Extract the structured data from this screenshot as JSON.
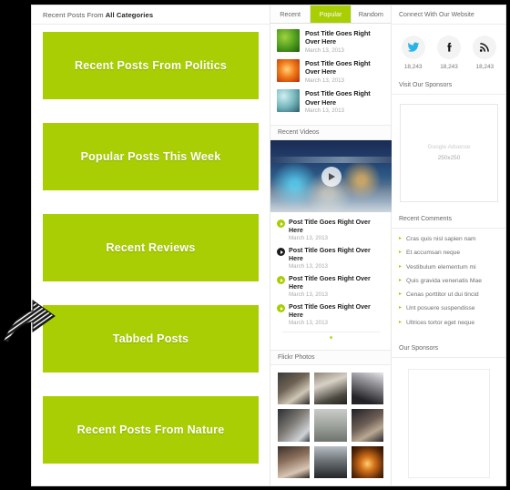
{
  "theme": {
    "accent": "#a9ce04",
    "page_bg": "#000000",
    "canvas_bg": "#ffffff"
  },
  "main": {
    "header_prefix": "Recent Posts From ",
    "header_strong": "All Categories",
    "blocks": [
      {
        "label": "Recent Posts From Politics"
      },
      {
        "label": "Popular Posts This Week"
      },
      {
        "label": "Recent Reviews"
      },
      {
        "label": "Tabbed Posts"
      },
      {
        "label": "Recent Posts From Nature"
      }
    ]
  },
  "middle": {
    "tabs": [
      {
        "label": "Recent",
        "active": false
      },
      {
        "label": "Popular",
        "active": true
      },
      {
        "label": "Random",
        "active": false
      }
    ],
    "posts": [
      {
        "title": "Post Title Goes Right Over Here",
        "date": "March 13, 2013",
        "thumb": "green-leaf-thumb"
      },
      {
        "title": "Post Title Goes Right Over Here",
        "date": "March 13, 2013",
        "thumb": "orange-flower-thumb"
      },
      {
        "title": "Post Title Goes Right Over Here",
        "date": "March 13, 2013",
        "thumb": "teal-water-thumb"
      }
    ],
    "videos_heading": "Recent Videos",
    "video_player": {
      "image": "city-night-street-photo",
      "play_icon": "play-icon"
    },
    "video_list": [
      {
        "title": "Post Title Goes Right Over Here",
        "date": "March 13, 2013",
        "state": "normal"
      },
      {
        "title": "Post Title Goes Right Over Here",
        "date": "March 13, 2013",
        "state": "active"
      },
      {
        "title": "Post Title Goes Right Over Here",
        "date": "March 13, 2013",
        "state": "normal"
      },
      {
        "title": "Post Title Goes Right Over Here",
        "date": "March 13, 2013",
        "state": "normal"
      }
    ],
    "more_arrow": "▾",
    "flickr_heading": "Flickr Photos",
    "flickr_photos": [
      "photo-1",
      "photo-2",
      "photo-3",
      "photo-4",
      "photo-5",
      "photo-6",
      "photo-7",
      "photo-8",
      "photo-9"
    ]
  },
  "sidebar": {
    "connect_heading": "Connect With Our Website",
    "social": [
      {
        "icon": "twitter-icon",
        "count": "18,243",
        "color": "#2ab3e8"
      },
      {
        "icon": "facebook-icon",
        "count": "18,243",
        "color": "#111111"
      },
      {
        "icon": "rss-icon",
        "count": "18,243",
        "color": "#111111"
      }
    ],
    "sponsors_heading": "Visit Our Sponsors",
    "ad": {
      "line1": "Google Adsense",
      "line2": "250x250"
    },
    "comments_heading": "Recent Comments",
    "comments": [
      "Cras quis nisl sapien nam",
      "Et accumsan neque",
      "Vestibulum elementum mi",
      "Quis gravida venenatis Mae",
      "Cenas porttitor ut dui tincid",
      "Unt posuere suspendisse",
      "Ultrices tortor eget neque"
    ],
    "our_sponsors_heading": "Our Sponsors"
  },
  "cursor": {
    "icon": "arrow-pointer-cursor"
  }
}
